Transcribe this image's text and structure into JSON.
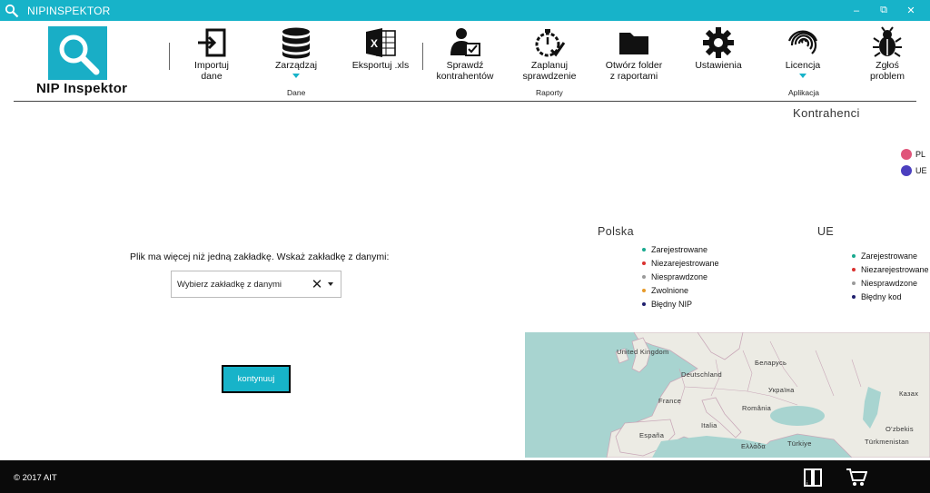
{
  "app": {
    "title": "NIPINSPEKTOR",
    "logo_text": "NIP Inspektor"
  },
  "window_controls": {
    "minimize": "–",
    "restore": "⧉",
    "close": "✕"
  },
  "toolbar": {
    "import": "Importuj dane",
    "manage": "Zarządzaj",
    "export": "Eksportuj .xls",
    "check": "Sprawdź kontrahentów",
    "schedule": "Zaplanuj sprawdzenie",
    "open_folder": "Otwórz folder z raportami",
    "settings": "Ustawienia",
    "license": "Licencja",
    "report_problem": "Zgłoś problem"
  },
  "groups": {
    "dane": "Dane",
    "raporty": "Raporty",
    "aplikacja": "Aplikacja"
  },
  "kontrahenci": {
    "title": "Kontrahenci",
    "legend": [
      {
        "label": "PL",
        "color": "#e0557a"
      },
      {
        "label": "UE",
        "color": "#4b3fbf"
      }
    ]
  },
  "polska": {
    "title": "Polska",
    "items": [
      {
        "label": "Zarejestrowane",
        "color": "#19a98f"
      },
      {
        "label": "Niezarejestrowane",
        "color": "#d9312f"
      },
      {
        "label": "Niesprawdzone",
        "color": "#9a9a9a"
      },
      {
        "label": "Zwolnione",
        "color": "#e79a2a"
      },
      {
        "label": "Błędny NIP",
        "color": "#1f1f6e"
      }
    ]
  },
  "ue": {
    "title": "UE",
    "items": [
      {
        "label": "Zarejestrowane",
        "color": "#19a98f"
      },
      {
        "label": "Niezarejestrowane",
        "color": "#d9312f"
      },
      {
        "label": "Niesprawdzone",
        "color": "#9a9a9a"
      },
      {
        "label": "Błędny kod",
        "color": "#1f1f6e"
      }
    ]
  },
  "form": {
    "prompt": "Plik ma więcej niż jedną zakładkę. Wskaż zakładkę z danymi:",
    "placeholder": "Wybierz zakładkę z danymi",
    "continue_label": "kontynuuj"
  },
  "map": {
    "labels": [
      "United Kingdom",
      "Deutschland",
      "Беларусь",
      "France",
      "Україна",
      "România",
      "Italia",
      "España",
      "Ελλάδα",
      "Türkiye",
      "Казах",
      "O'zbekis",
      "Türkmenistan"
    ],
    "sea_color": "#a8d4d0",
    "land_color": "#ecebe4"
  },
  "footer": {
    "copyright": "© 2017 AIT"
  },
  "colors": {
    "accent": "#17b3c9",
    "footer_bg": "#0a0a0a"
  }
}
